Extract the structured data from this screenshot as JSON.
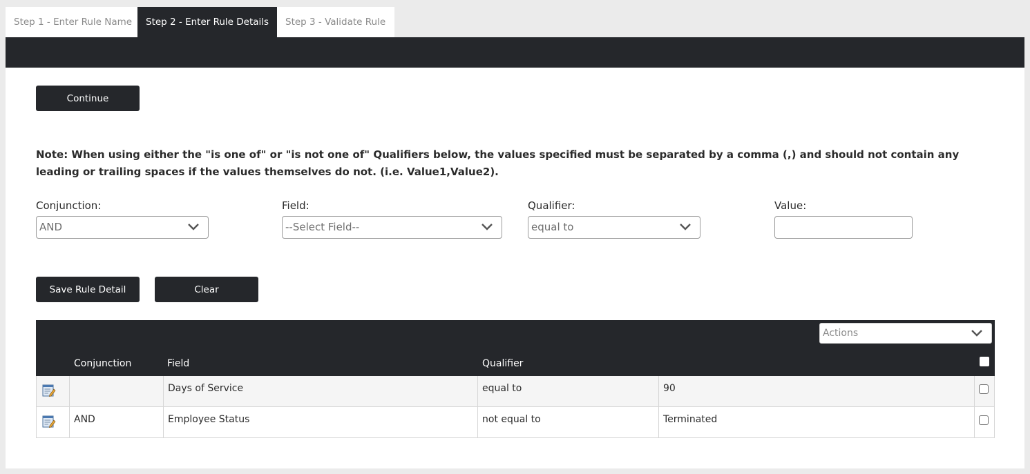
{
  "tabs": [
    {
      "label": "Step 1 - Enter Rule Name"
    },
    {
      "label": "Step 2 - Enter Rule Details"
    },
    {
      "label": "Step 3 - Validate Rule"
    }
  ],
  "continue_label": "Continue",
  "note": "Note: When using either the \"is one of\" or \"is not one of\" Qualifiers below, the values specified must be separated by a comma (,) and should not contain any leading or trailing spaces if the values themselves do not. (i.e. Value1,Value2).",
  "form": {
    "conjunction": {
      "label": "Conjunction:",
      "value": "AND"
    },
    "field": {
      "label": "Field:",
      "value": "--Select Field--"
    },
    "qualifier": {
      "label": "Qualifier:",
      "value": "equal to"
    },
    "value": {
      "label": "Value:",
      "value": ""
    }
  },
  "buttons": {
    "save": "Save Rule Detail",
    "clear": "Clear"
  },
  "grid": {
    "actions_placeholder": "Actions",
    "headers": {
      "conjunction": "Conjunction",
      "field": "Field",
      "qualifier": "Qualifier"
    },
    "rows": [
      {
        "conjunction": "",
        "field": "Days of Service",
        "qualifier": "equal to",
        "value": "90"
      },
      {
        "conjunction": "AND",
        "field": "Employee Status",
        "qualifier": "not equal to",
        "value": "Terminated"
      }
    ]
  }
}
